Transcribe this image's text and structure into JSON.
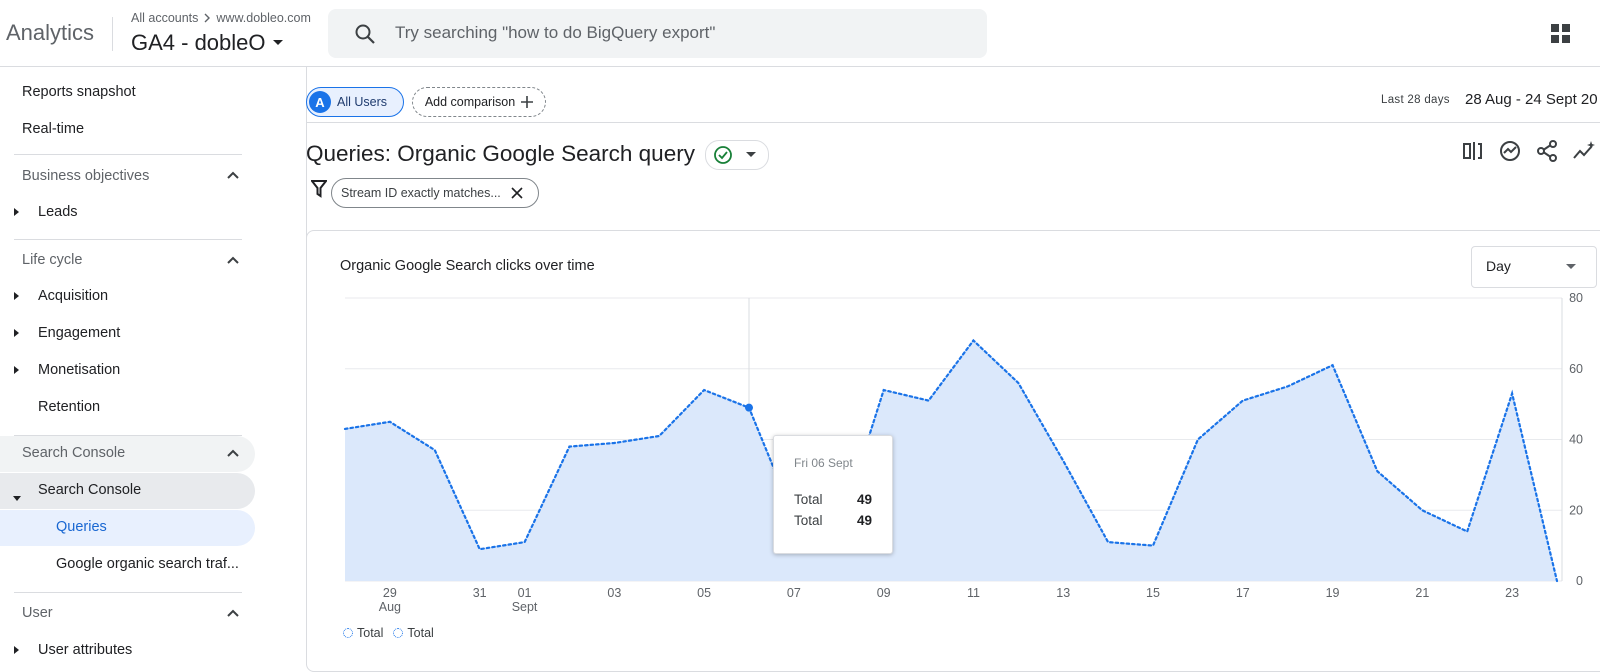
{
  "header": {
    "app_name": "Analytics",
    "breadcrumb_account": "All accounts",
    "breadcrumb_site": "www.dobleo.com",
    "property": "GA4 - dobleO",
    "search_placeholder": "Try searching \"how to do BigQuery export\""
  },
  "sidebar": {
    "reports_snapshot": "Reports snapshot",
    "realtime": "Real-time",
    "business_objectives": "Business objectives",
    "leads": "Leads",
    "life_cycle": "Life cycle",
    "acquisition": "Acquisition",
    "engagement": "Engagement",
    "monetisation": "Monetisation",
    "retention": "Retention",
    "search_console_section": "Search Console",
    "search_console_item": "Search Console",
    "queries": "Queries",
    "google_organic": "Google organic search traf...",
    "user": "User",
    "user_attributes": "User attributes"
  },
  "main": {
    "segment_letter": "A",
    "segment_label": "All Users",
    "add_comparison": "Add comparison",
    "date_label": "Last 28 days",
    "date_range": "28 Aug - 24 Sept 20",
    "title": "Queries: Organic Google Search query",
    "filter_text": "Stream ID exactly matches...",
    "card_title": "Organic Google Search clicks over time",
    "granularity": "Day"
  },
  "tooltip": {
    "date": "Fri 06 Sept",
    "rows": [
      {
        "label": "Total",
        "value": "49"
      },
      {
        "label": "Total",
        "value": "49"
      }
    ]
  },
  "colors": {
    "accent": "#1a73e8",
    "area_fill": "#dbe8fb",
    "selected_bg": "#e8f0fe",
    "active_bg": "#e8eaed"
  },
  "chart_data": {
    "type": "area",
    "x": [
      "28 Aug",
      "29 Aug",
      "30 Aug",
      "31 Aug",
      "01 Sept",
      "02 Sept",
      "03 Sept",
      "04 Sept",
      "05 Sept",
      "06 Sept",
      "07 Sept",
      "08 Sept",
      "09 Sept",
      "10 Sept",
      "11 Sept",
      "12 Sept",
      "13 Sept",
      "14 Sept",
      "15 Sept",
      "16 Sept",
      "17 Sept",
      "18 Sept",
      "19 Sept",
      "20 Sept",
      "21 Sept",
      "22 Sept",
      "23 Sept",
      "24 Sept"
    ],
    "series": [
      {
        "name": "Total",
        "values": [
          43,
          45,
          37,
          9,
          11,
          38,
          39,
          41,
          54,
          49,
          18,
          14,
          54,
          51,
          68,
          56,
          34,
          11,
          10,
          40,
          51,
          55,
          61,
          31,
          20,
          14,
          53,
          0
        ]
      }
    ],
    "x_ticks": [
      {
        "label": "29",
        "sub": "Aug",
        "index": 1
      },
      {
        "label": "31",
        "sub": "",
        "index": 3
      },
      {
        "label": "01",
        "sub": "Sept",
        "index": 4
      },
      {
        "label": "03",
        "sub": "",
        "index": 6
      },
      {
        "label": "05",
        "sub": "",
        "index": 8
      },
      {
        "label": "07",
        "sub": "",
        "index": 10
      },
      {
        "label": "09",
        "sub": "",
        "index": 12
      },
      {
        "label": "11",
        "sub": "",
        "index": 14
      },
      {
        "label": "13",
        "sub": "",
        "index": 16
      },
      {
        "label": "15",
        "sub": "",
        "index": 18
      },
      {
        "label": "17",
        "sub": "",
        "index": 20
      },
      {
        "label": "19",
        "sub": "",
        "index": 22
      },
      {
        "label": "21",
        "sub": "",
        "index": 24
      },
      {
        "label": "23",
        "sub": "",
        "index": 26
      }
    ],
    "y_ticks": [
      0,
      20,
      40,
      60,
      80
    ],
    "ylim": [
      0,
      80
    ],
    "highlight_index": 9,
    "legend": [
      "Total",
      "Total"
    ],
    "grid": true,
    "y_axis_side": "right"
  }
}
